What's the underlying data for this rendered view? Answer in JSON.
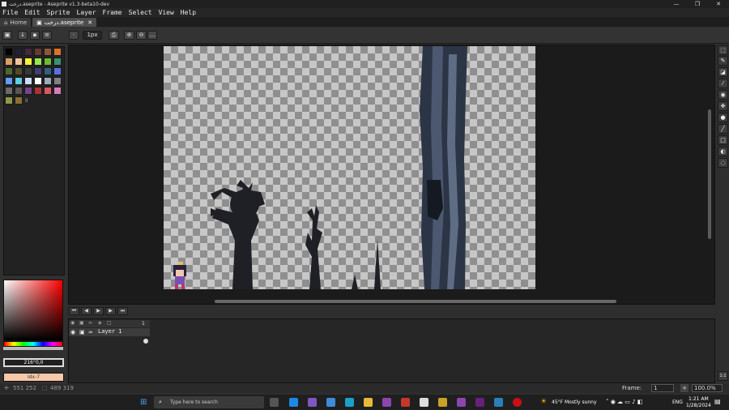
{
  "window": {
    "title": "درخت.aseprite - Aseprite v1.3-beta10-dev",
    "controls": [
      "—",
      "❐",
      "✕"
    ]
  },
  "menu": [
    "File",
    "Edit",
    "Sprite",
    "Layer",
    "Frame",
    "Select",
    "View",
    "Help"
  ],
  "tabs": [
    {
      "label": "Home",
      "active": false
    },
    {
      "label": "درخت.aseprite",
      "active": true,
      "close": "✕"
    }
  ],
  "context_bar": {
    "brush_size": "1px",
    "dot": "·",
    "more": "..."
  },
  "palette": {
    "count_label": "II",
    "colors": [
      "#000000",
      "#222034",
      "#45283c",
      "#663931",
      "#8f563b",
      "#df7126",
      "#d9a066",
      "#eec39a",
      "#fbf236",
      "#99e550",
      "#6abe30",
      "#37946e",
      "#4b692f",
      "#524b24",
      "#323c39",
      "#3f3f74",
      "#306082",
      "#5b6ee1",
      "#639bff",
      "#5fcde4",
      "#cbdbfc",
      "#ffffff",
      "#9badb7",
      "#847e87",
      "#696a6a",
      "#595652",
      "#76428a",
      "#ac3232",
      "#d95763",
      "#d77bba",
      "#8f974a",
      "#8a6f30"
    ]
  },
  "color_fields": {
    "foreground": "216°0,0",
    "background": "Idx-7"
  },
  "timeline": {
    "layer_name": "Layer 1",
    "frame_number": "1"
  },
  "status": {
    "cursor": "551 252",
    "selection": "489 319",
    "frame_label": "Frame:",
    "frame_value": "1",
    "zoom": "100.0%",
    "add": "+",
    "page_indicator": "1:1"
  },
  "taskbar": {
    "search_placeholder": "Type here to search",
    "weather": "45°F  Mostly sunny",
    "lang": "ENG",
    "time": "1:21 AM",
    "date": "1/28/2024"
  },
  "accent_colors": {
    "canvas_dark_check": "#8f8f8f",
    "canvas_light_check": "#c7c7c7",
    "tree_trunk": "#3b4658",
    "foreground_color": "#000000",
    "background_color": "#f7c9a8"
  }
}
